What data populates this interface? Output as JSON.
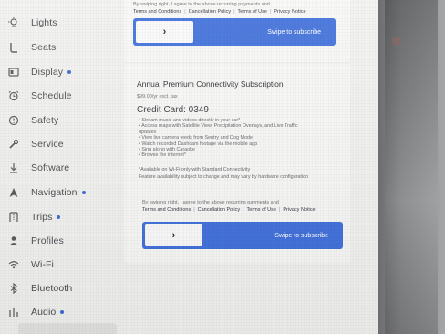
{
  "sidebar": {
    "items": [
      {
        "label": "Lights",
        "icon": "lightbulb-icon",
        "dot": false
      },
      {
        "label": "Seats",
        "icon": "seat-icon",
        "dot": false
      },
      {
        "label": "Display",
        "icon": "display-icon",
        "dot": true
      },
      {
        "label": "Schedule",
        "icon": "alarm-clock-icon",
        "dot": false
      },
      {
        "label": "Safety",
        "icon": "safety-icon",
        "dot": false
      },
      {
        "label": "Service",
        "icon": "wrench-icon",
        "dot": false
      },
      {
        "label": "Software",
        "icon": "download-icon",
        "dot": false
      },
      {
        "label": "Navigation",
        "icon": "navigation-arrow-icon",
        "dot": true
      },
      {
        "label": "Trips",
        "icon": "trips-icon",
        "dot": true
      },
      {
        "label": "Profiles",
        "icon": "profile-icon",
        "dot": false
      },
      {
        "label": "Wi-Fi",
        "icon": "wifi-icon",
        "dot": false
      },
      {
        "label": "Bluetooth",
        "icon": "bluetooth-icon",
        "dot": false
      },
      {
        "label": "Audio",
        "icon": "audio-icon",
        "dot": true
      }
    ],
    "dot_color": "#3d68d8"
  },
  "top_card": {
    "consent_text": "By swiping right, I agree to the above recurring payments and",
    "links": [
      "Terms and Conditions",
      "Cancellation Policy",
      "Terms of Use",
      "Privacy Notice"
    ],
    "swipe_label": "Swipe to subscribe",
    "knob_glyph": "›"
  },
  "subscription": {
    "title": "Annual Premium Connectivity Subscription",
    "price": "$99.00/yr excl. tax",
    "credit_card": "Credit Card: 0349",
    "features": [
      "• Stream music and videos directly in your car*",
      "• Access maps with Satellite View, Precipitation Overlays, and Live Traffic",
      "  updates",
      "• View live camera feeds from Sentry and Dog Mode",
      "• Watch recorded Dashcam footage via the mobile app",
      "• Sing along with Caraoke",
      "• Browse the internet*"
    ],
    "footnote_1": "*Available on Wi-Fi only with Standard Connectivity",
    "footnote_2": "Feature availability subject to change and may vary by hardware configuration",
    "consent_text": "By swiping right, I agree to the above recurring payments and",
    "links": [
      "Terms and Conditions",
      "Cancellation Policy",
      "Terms of Use",
      "Privacy Notice"
    ],
    "swipe_label": "Swipe to subscribe",
    "knob_glyph": "›"
  },
  "colors": {
    "accent": "#3f6fdc",
    "screen_bg": "#f2f2f0",
    "card_bg": "#f8f8f6"
  }
}
